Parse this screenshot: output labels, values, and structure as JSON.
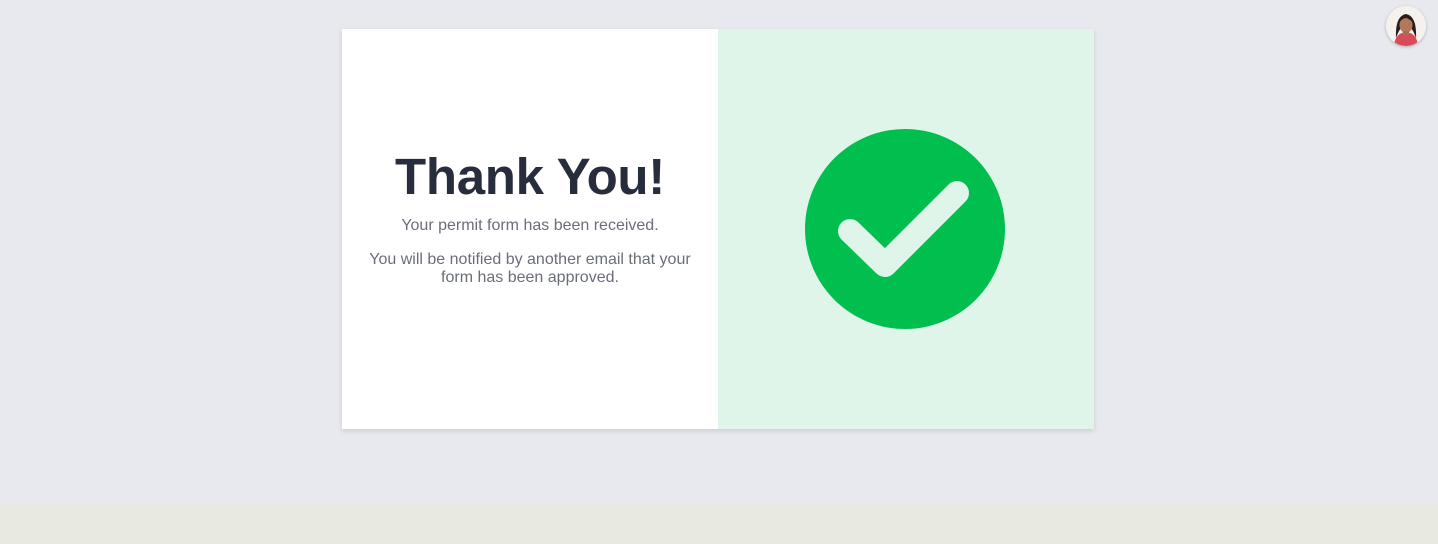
{
  "confirmation": {
    "title": "Thank You!",
    "message_received": "Your permit form has been received.",
    "message_notify": "You will be notified by another email that your form has been approved."
  },
  "icons": {
    "success": "check-circle-icon",
    "profile": "user-avatar"
  },
  "colors": {
    "page_background": "#e8e9ee",
    "footer_background": "#e8e9e0",
    "card_left": "#ffffff",
    "card_right": "#e0f5e9",
    "success_green": "#00bf4f",
    "title_text": "#282d3e",
    "body_text": "#6a6e7a"
  }
}
